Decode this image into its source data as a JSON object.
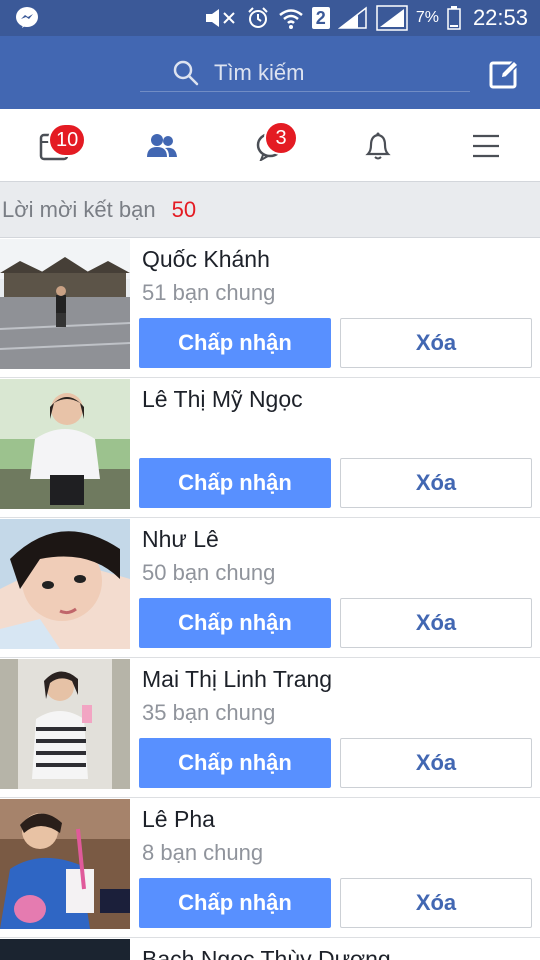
{
  "status_bar": {
    "messenger_icon": "messenger-icon",
    "sim_number": "2",
    "battery_percent": "7%",
    "time": "22:53"
  },
  "header": {
    "search_placeholder": "Tìm kiếm",
    "search_icon": "search-icon",
    "compose_icon": "compose-icon",
    "background": "#4267b2"
  },
  "nav": {
    "items": [
      {
        "icon": "news-feed-icon",
        "badge": "10"
      },
      {
        "icon": "friend-requests-icon",
        "badge": ""
      },
      {
        "icon": "messages-icon",
        "badge": "3"
      },
      {
        "icon": "notifications-icon",
        "badge": ""
      },
      {
        "icon": "menu-icon",
        "badge": ""
      }
    ],
    "active_color": "#4267b2"
  },
  "requests": {
    "title": "Lời mời kết bạn",
    "count": "50",
    "accept_label": "Chấp nhận",
    "delete_label": "Xóa",
    "items": [
      {
        "name": "Quốc Khánh",
        "mutual": "51 bạn chung"
      },
      {
        "name": "Lê Thị Mỹ Ngọc",
        "mutual": ""
      },
      {
        "name": "Như Lê",
        "mutual": "50 bạn chung"
      },
      {
        "name": "Mai Thị Linh Trang",
        "mutual": "35 bạn chung"
      },
      {
        "name": "Lê Pha",
        "mutual": "8 bạn chung"
      },
      {
        "name": "Bạch Ngọc Thùy Dương",
        "mutual": ""
      }
    ]
  },
  "colors": {
    "accent": "#5890ff",
    "badge": "#e41b23"
  }
}
